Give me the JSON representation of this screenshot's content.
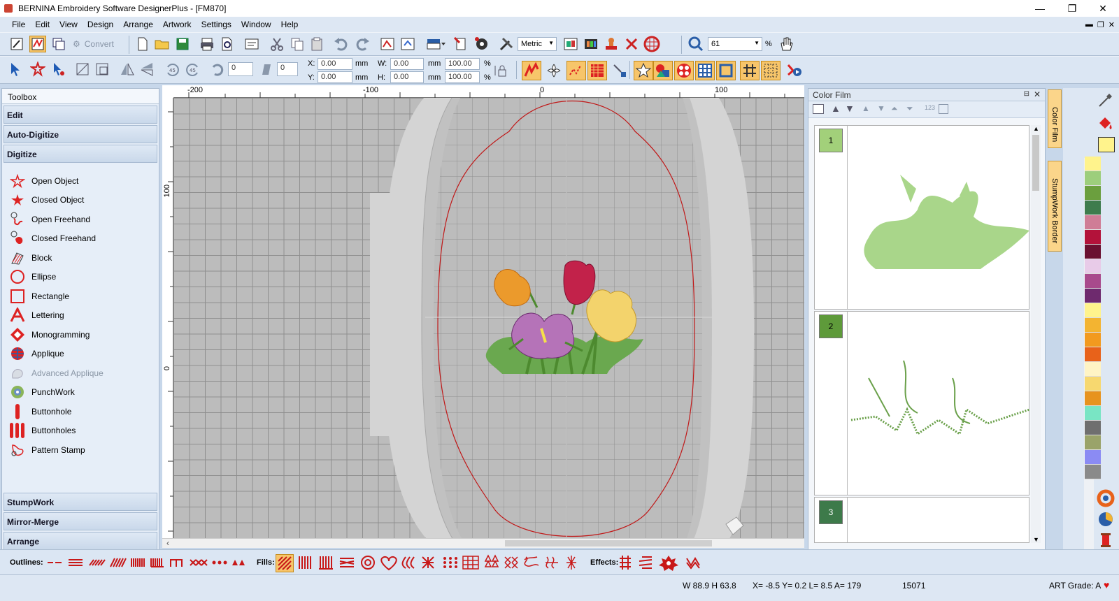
{
  "window": {
    "title": "BERNINA Embroidery Software DesignerPlus - [FM870]",
    "minimize": "—",
    "restore": "❐",
    "close": "✕"
  },
  "menu": [
    "File",
    "Edit",
    "View",
    "Design",
    "Arrange",
    "Artwork",
    "Settings",
    "Window",
    "Help"
  ],
  "toolbar1": {
    "convert_label": "Convert",
    "units": "Metric",
    "zoom": "61",
    "zoom_unit": "%"
  },
  "toolbar2": {
    "rotate_value": "0",
    "slant_value": "0",
    "x_label": "X:",
    "x_value": "0.00",
    "y_label": "Y:",
    "y_value": "0.00",
    "w_label": "W:",
    "w_value": "0.00",
    "h_label": "H:",
    "h_value": "0.00",
    "mm": "mm",
    "pct_w": "100.00",
    "pct_h": "100.00",
    "pct": "%"
  },
  "toolbox": {
    "title": "Toolbox",
    "top_sections": [
      "Edit",
      "Auto-Digitize",
      "Digitize"
    ],
    "tools": [
      "Open Object",
      "Closed Object",
      "Open Freehand",
      "Closed Freehand",
      "Block",
      "Ellipse",
      "Rectangle",
      "Lettering",
      "Monogramming",
      "Applique",
      "Advanced Applique",
      "PunchWork",
      "Buttonhole",
      "Buttonholes",
      "Pattern Stamp"
    ],
    "bottom_sections": [
      "StumpWork",
      "Mirror-Merge",
      "Arrange"
    ]
  },
  "ruler": {
    "top": [
      "-200",
      "-100",
      "0",
      "100"
    ],
    "left": [
      "100",
      "0"
    ]
  },
  "color_film": {
    "title": "Color Film",
    "items": [
      {
        "num": "1",
        "color": "#a2d07a"
      },
      {
        "num": "2",
        "color": "#5e9a3a"
      },
      {
        "num": "3",
        "color": "#3d7a4a"
      }
    ]
  },
  "vertical_tabs": [
    "Color Film",
    "StumpWork Border"
  ],
  "palette": [
    "#fff38c",
    "#9dce7c",
    "#6b9f3e",
    "#3e7c4d",
    "#cf7d96",
    "#b3123a",
    "#6a1030",
    "#e8cbe8",
    "#a84a8c",
    "#6e2a6e",
    "#fff38c",
    "#f3b431",
    "#f29a1f",
    "#e8621a",
    "#fff4c4",
    "#f7d86f",
    "#e7931e",
    "#79e5c4",
    "#6f6f6f",
    "#9aa36a",
    "#8b8bf3",
    "#8a8a8a"
  ],
  "bottom": {
    "outlines_label": "Outlines:",
    "fills_label": "Fills:",
    "effects_label": "Effects:"
  },
  "status": {
    "dims": "W  88.9 H  63.8",
    "coords": "X=  -8.5 Y=   0.2 L=   8.5 A= 179",
    "stitches": "15071",
    "art_grade": "ART Grade: A"
  }
}
